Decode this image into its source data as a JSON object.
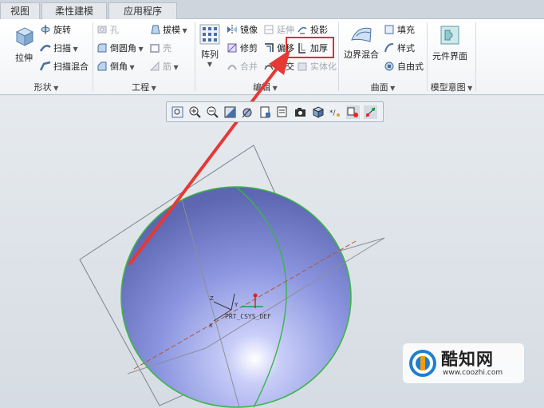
{
  "tabs": [
    {
      "label": "视图"
    },
    {
      "label": "柔性建模"
    },
    {
      "label": "应用程序"
    }
  ],
  "ribbon": {
    "shape": {
      "label": "形状",
      "extrude": "拉伸",
      "revolve": "旋转",
      "sweep": "扫描",
      "swept_blend": "扫描混合"
    },
    "engineering": {
      "label": "工程",
      "hole": "孔",
      "round": "倒圆角",
      "chamfer": "倒角",
      "draft": "拔模",
      "shell": "壳",
      "rib": "筋"
    },
    "editing": {
      "label": "编辑",
      "pattern": "阵列",
      "mirror": "镜像",
      "trim": "修剪",
      "merge": "合并",
      "extend": "延伸",
      "offset": "偏移",
      "intersect": "相交",
      "project": "投影",
      "thicken": "加厚",
      "solidify": "实体化"
    },
    "surfaces": {
      "label": "曲面",
      "boundary_blend": "边界混合",
      "fill": "填充",
      "style": "样式",
      "freestyle": "自由式"
    },
    "model_intent": {
      "label": "模型意图",
      "component_interface": "元件界面"
    }
  },
  "viewport": {
    "csys_label": "PRT_CSYS_DEF",
    "axis_x": "X",
    "axis_y": "Y",
    "axis_z": "Z"
  },
  "watermark": {
    "title": "酷知网",
    "url": "www.coozhi.com"
  },
  "colors": {
    "highlight_box": "#e0302a",
    "arrow": "#e53935",
    "sphere": "#8f98e0",
    "sphere_edge": "#3bb54a"
  }
}
